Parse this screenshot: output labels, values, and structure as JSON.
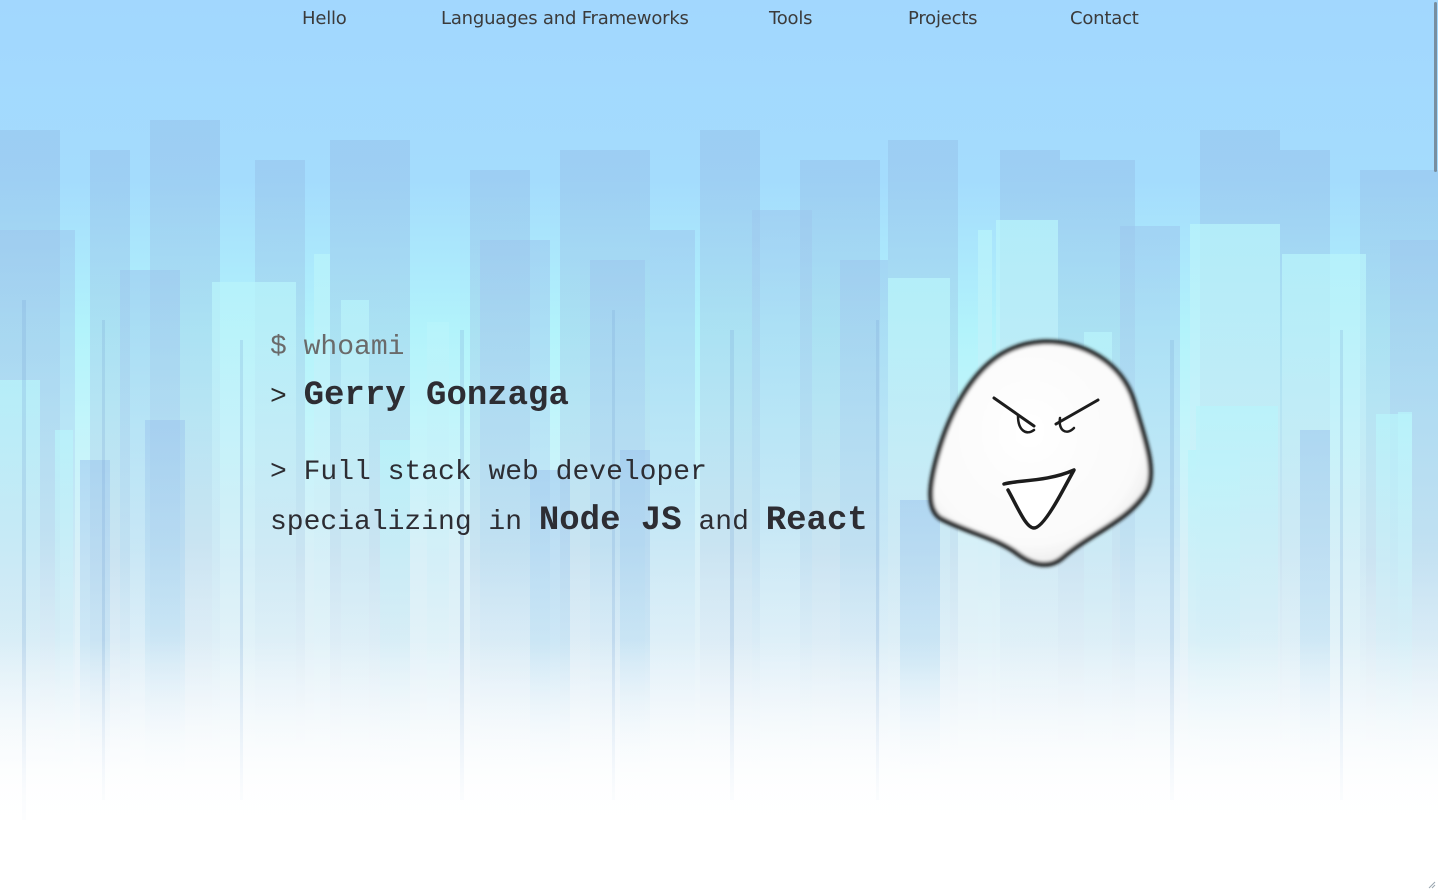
{
  "nav": {
    "items": [
      {
        "label": "Hello"
      },
      {
        "label": "Languages and Frameworks"
      },
      {
        "label": "Tools"
      },
      {
        "label": "Projects"
      },
      {
        "label": "Contact"
      }
    ]
  },
  "hero": {
    "command_prompt": "$",
    "command": "whoami",
    "output_prompt": ">",
    "name": "Gerry Gonzaga",
    "tagline_prefix": "Full stack web developer",
    "tagline_mid": "specializing in",
    "tech_1": "Node JS",
    "tagline_and": "and",
    "tech_2": "React"
  },
  "avatar": {
    "icon": "smirking-ghost-icon"
  },
  "colors": {
    "sky_top": "#a2d7fe",
    "sky_mid": "#b2f3fb",
    "text_dark": "#2d2d33",
    "text_muted": "#6a6a6a"
  }
}
